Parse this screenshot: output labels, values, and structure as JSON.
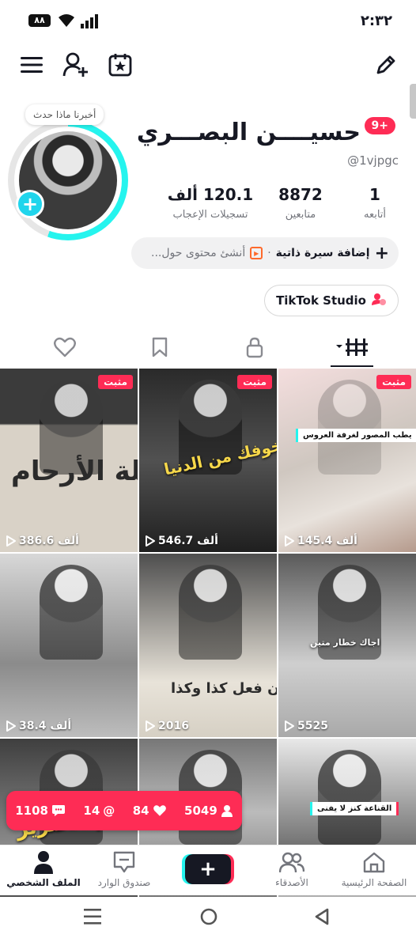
{
  "status_bar": {
    "time": "٢:٣٢",
    "battery": "٨٨"
  },
  "profile": {
    "tooltip": "أخبرنا ماذا حدث",
    "name": "حسيــــن البصـــري",
    "badge": "9+",
    "handle": "@1vjpgc",
    "stats": [
      {
        "value": "1",
        "label": "أتابعه"
      },
      {
        "value": "8872",
        "label": "متابعين"
      },
      {
        "value": "120.1 ألف",
        "label": "تسجيلات الإعجاب"
      }
    ],
    "bio_add": "إضافة سيرة ذاتية",
    "bio_hint": "أنشئ محتوى حول...",
    "studio_label": "TikTok Studio"
  },
  "pinned_label": "مثبت",
  "videos": [
    {
      "views": "145.4 ألف",
      "pinned": true,
      "caption": "يطب المصور لغرفة العروس"
    },
    {
      "views": "546.7 ألف",
      "pinned": true,
      "caption": "خوفك من الدنيا"
    },
    {
      "views": "386.6 ألف",
      "pinned": true,
      "caption": "صلة الأرحام"
    },
    {
      "views": "5525",
      "pinned": false,
      "caption": "اجاك خطار متين"
    },
    {
      "views": "2016",
      "pinned": false,
      "caption": "فلان فعل كذا وكذا"
    },
    {
      "views": "38.4 ألف",
      "pinned": false,
      "caption": ""
    },
    {
      "views": "",
      "pinned": false,
      "caption": "القناعة كنز لا يفنى"
    },
    {
      "views": "",
      "pinned": false,
      "caption": ""
    },
    {
      "views": "",
      "pinned": false,
      "caption": "لحم الخنزير"
    }
  ],
  "toast": {
    "comments": "1108",
    "mentions": "14",
    "likes": "84",
    "followers": "5049"
  },
  "bottom_nav": {
    "home": "الصفحة الرئيسية",
    "friends": "الأصدقاء",
    "inbox": "صندوق الوارد",
    "profile": "الملف الشخصي"
  },
  "colors": {
    "accent": "#fe2c55",
    "cyan": "#25f4ee"
  }
}
